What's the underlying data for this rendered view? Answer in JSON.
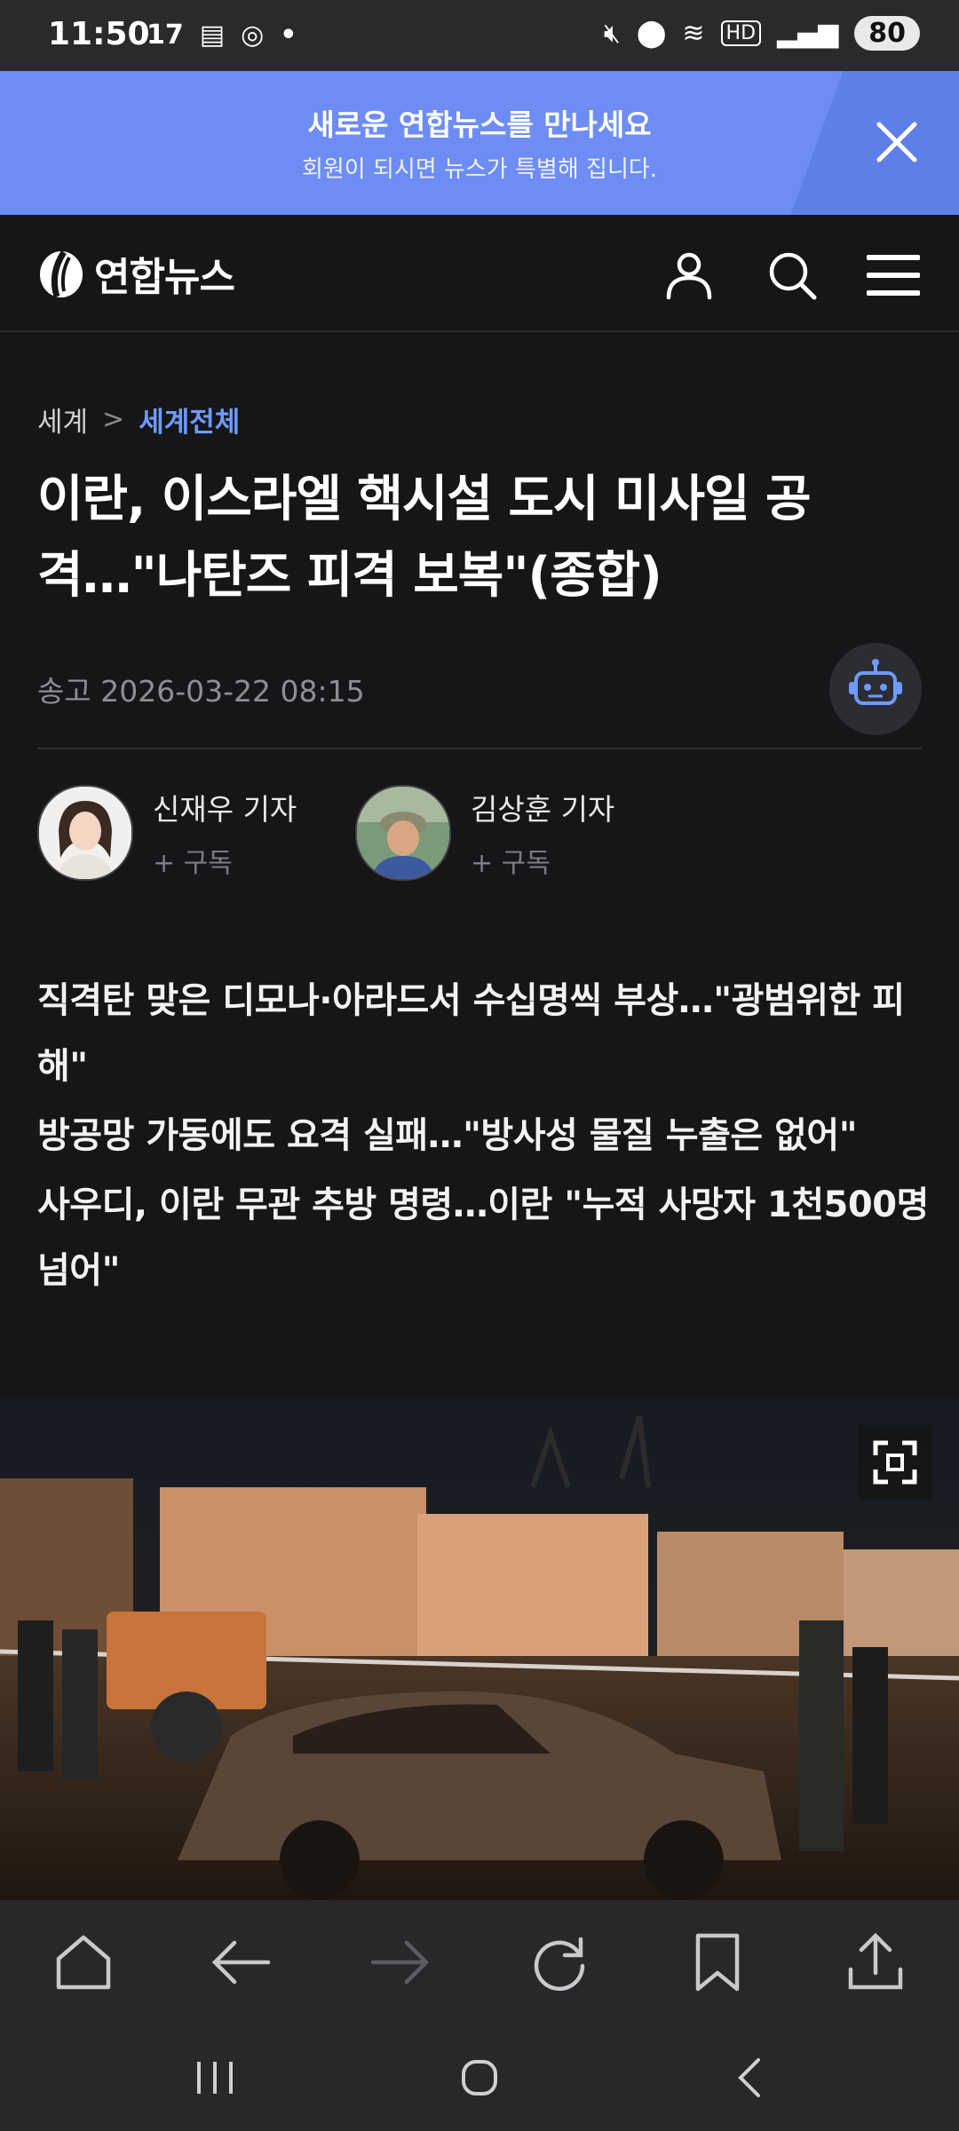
{
  "status_bar": {
    "time": "11:50",
    "extra": "17",
    "battery": "80"
  },
  "banner": {
    "title": "새로운 연합뉴스를 만나세요",
    "subtitle": "회원이 되시면 뉴스가 특별해 집니다."
  },
  "header": {
    "logo_text": "연합뉴스"
  },
  "breadcrumb": {
    "section": "세계",
    "separator": ">",
    "subsection": "세계전체"
  },
  "article": {
    "headline": "이란, 이스라엘 핵시설 도시 미사일 공격…\"나탄즈 피격 보복\"(종합)",
    "meta": "송고 2026-03-22 08:15",
    "reporters": [
      {
        "name": "신재우 기자",
        "subscribe": "+ 구독"
      },
      {
        "name": "김상훈 기자",
        "subscribe": "+ 구독"
      }
    ],
    "summary": [
      "직격탄 맞은 디모나·아라드서 수십명씩 부상…\"광범위한 피해\"",
      "방공망 가동에도 요격 실패…\"방사성 물질 누출은 없어\"",
      "사우디, 이란 무관 추방 명령…이란 \"누적 사망자 1천500명 넘어\""
    ]
  },
  "icons": {
    "banner_close": "close-icon",
    "header": [
      "user-icon",
      "search-icon",
      "menu-icon"
    ],
    "bottom_toolbar": [
      "home-icon",
      "back-arrow-icon",
      "forward-arrow-icon",
      "refresh-icon",
      "bookmark-icon",
      "share-icon"
    ],
    "nav": [
      "recent-apps-icon",
      "home-circle-icon",
      "back-chevron-icon"
    ]
  },
  "colors": {
    "banner_bg": "#6d8df5",
    "accent_link": "#6e9bff",
    "page_bg": "#161618"
  }
}
